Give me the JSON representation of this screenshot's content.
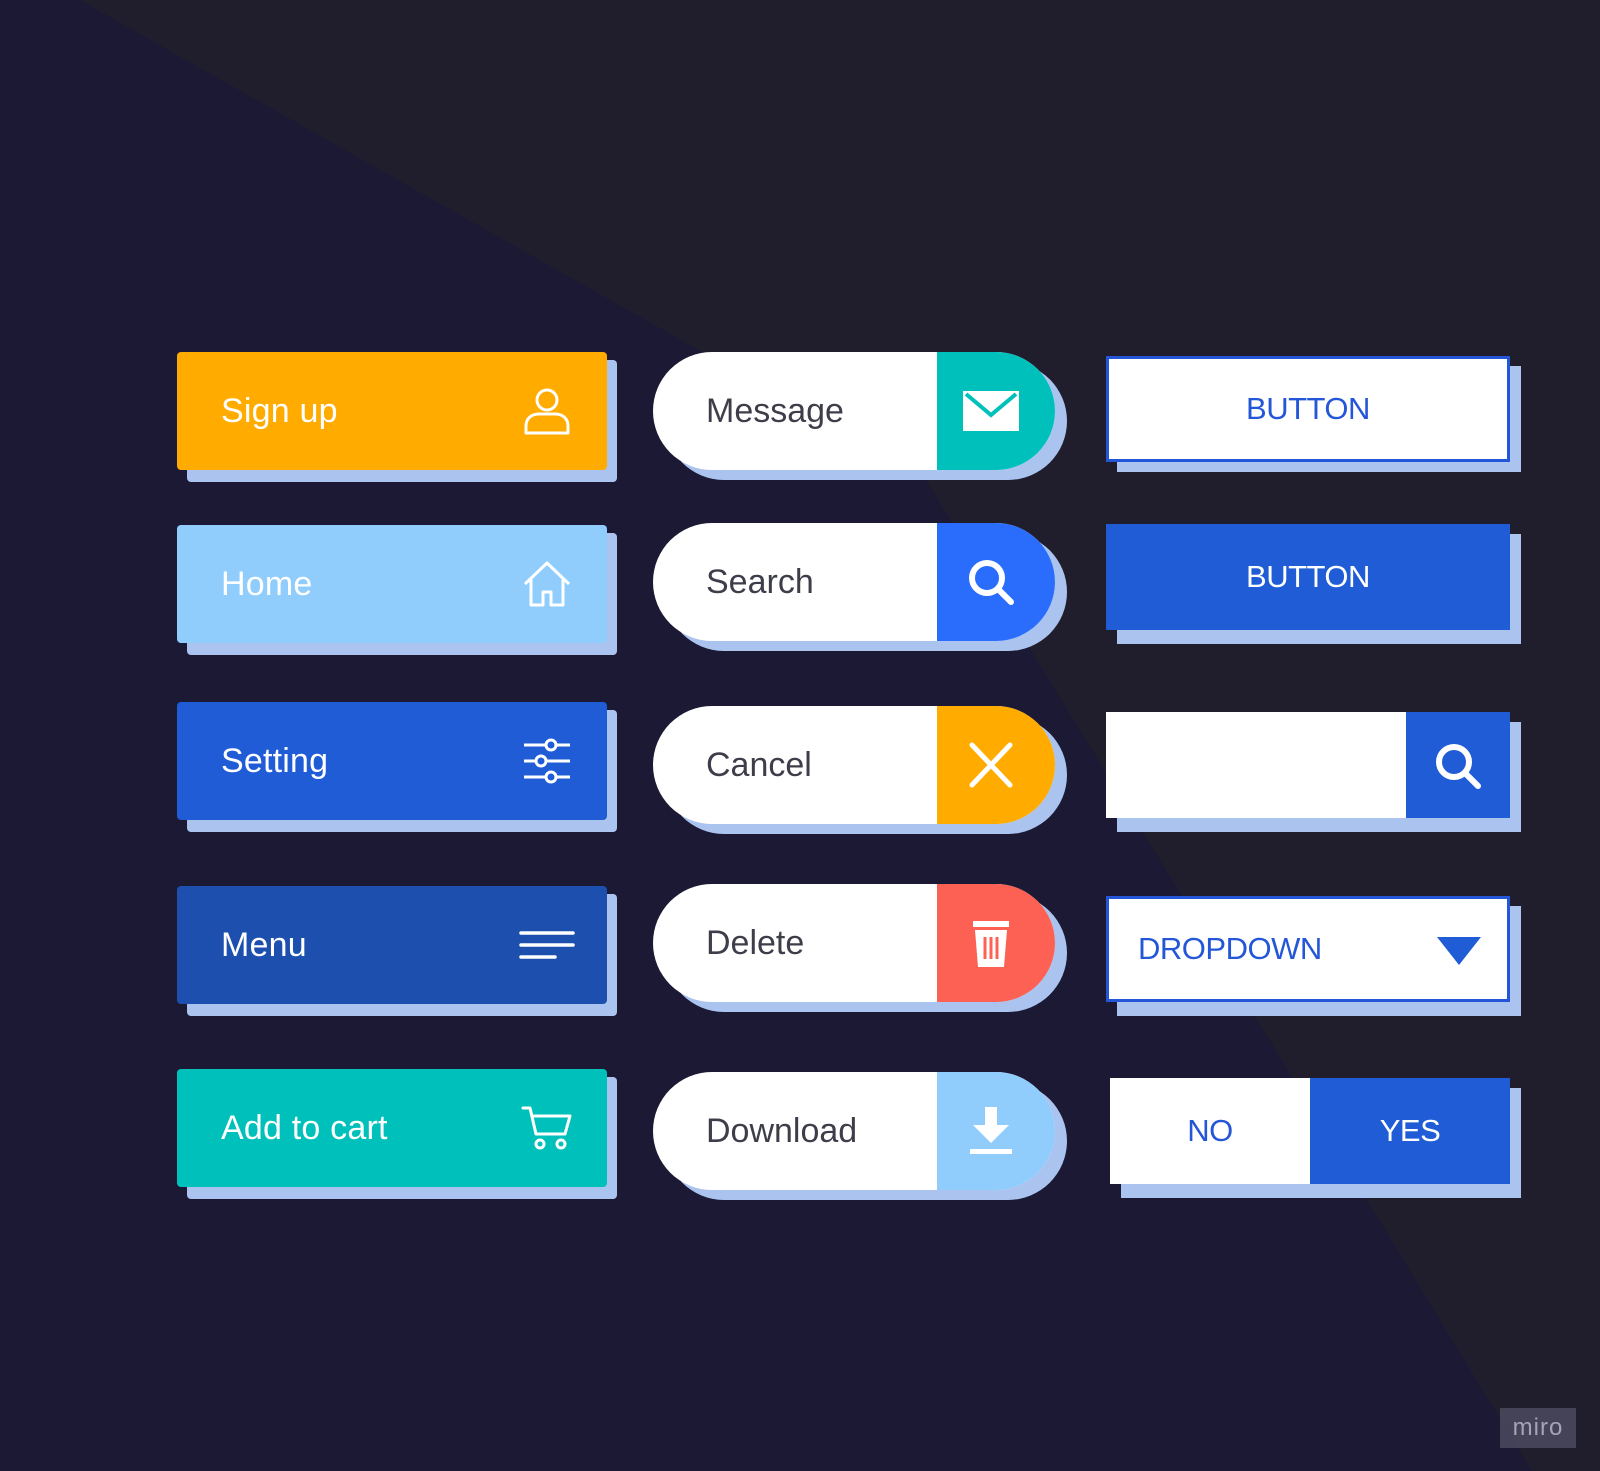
{
  "colors": {
    "background_dark": "#1c1934",
    "background_light": "#201e2c",
    "shadow": "#aac4ef",
    "orange": "#ffab00",
    "light_blue": "#90cdfc",
    "blue": "#1f5cd6",
    "dark_blue": "#1c4fae",
    "teal": "#00c0bb",
    "search_blue": "#2a6dfd",
    "red": "#fc6153",
    "outline_blue": "#2456d8"
  },
  "left_buttons": [
    {
      "label": "Sign up",
      "icon": "user-icon",
      "color": "#ffab00"
    },
    {
      "label": "Home",
      "icon": "home-icon",
      "color": "#90cdfc"
    },
    {
      "label": "Setting",
      "icon": "sliders-icon",
      "color": "#1f5cd6"
    },
    {
      "label": "Menu",
      "icon": "menu-icon",
      "color": "#1c4fae"
    },
    {
      "label": "Add to cart",
      "icon": "cart-icon",
      "color": "#00c0bb"
    }
  ],
  "pill_buttons": [
    {
      "label": "Message",
      "icon": "mail-icon",
      "color": "#00c0bb"
    },
    {
      "label": "Search",
      "icon": "search-icon",
      "color": "#2a6dfd"
    },
    {
      "label": "Cancel",
      "icon": "close-icon",
      "color": "#ffab00"
    },
    {
      "label": "Delete",
      "icon": "trash-icon",
      "color": "#fc6153"
    },
    {
      "label": "Download",
      "icon": "download-icon",
      "color": "#90cdfc"
    }
  ],
  "right_controls": {
    "outline_button_label": "BUTTON",
    "filled_button_label": "BUTTON",
    "search_input_value": "",
    "search_button_icon": "search-icon",
    "dropdown_label": "DROPDOWN",
    "dropdown_icon": "caret-down-icon",
    "toggle_no_label": "NO",
    "toggle_yes_label": "YES",
    "toggle_selected": "YES"
  },
  "watermark": "miro"
}
